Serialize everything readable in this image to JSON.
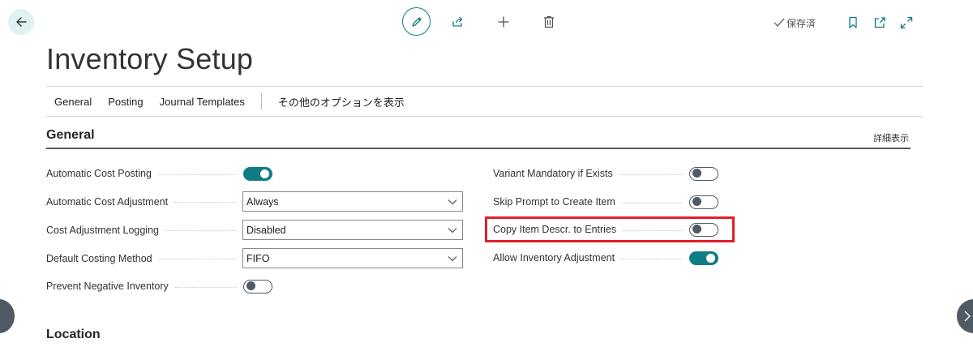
{
  "window": {
    "title": "Inventory Setup",
    "saved_status": "保存済"
  },
  "toolbar": {
    "icons": [
      "back-arrow-icon",
      "edit-pencil-icon",
      "share-icon",
      "new-plus-icon",
      "delete-trash-icon",
      "bookmark-icon",
      "open-new-window-icon",
      "expand-icon"
    ]
  },
  "tabs": [
    "General",
    "Posting",
    "Journal Templates"
  ],
  "more_options_label": "その他のオプションを表示",
  "general": {
    "title": "General",
    "show_more": "詳細表示",
    "left_fields": [
      {
        "label": "Automatic Cost Posting",
        "type": "toggle",
        "value": true
      },
      {
        "label": "Automatic Cost Adjustment",
        "type": "select",
        "value": "Always"
      },
      {
        "label": "Cost Adjustment Logging",
        "type": "select",
        "value": "Disabled"
      },
      {
        "label": "Default Costing Method",
        "type": "select",
        "value": "FIFO"
      },
      {
        "label": "Prevent Negative Inventory",
        "type": "toggle",
        "value": false
      }
    ],
    "right_fields": [
      {
        "label": "Variant Mandatory if Exists",
        "type": "toggle",
        "value": false
      },
      {
        "label": "Skip Prompt to Create Item",
        "type": "toggle",
        "value": false
      },
      {
        "label": "Copy Item Descr. to Entries",
        "type": "toggle",
        "value": false,
        "highlighted": true
      },
      {
        "label": "Allow Inventory Adjustment",
        "type": "toggle",
        "value": true
      }
    ]
  },
  "location": {
    "title": "Location"
  },
  "colors": {
    "accent": "#0f7d85",
    "highlight": "#e0202a",
    "toggle_off": "#505a64"
  }
}
